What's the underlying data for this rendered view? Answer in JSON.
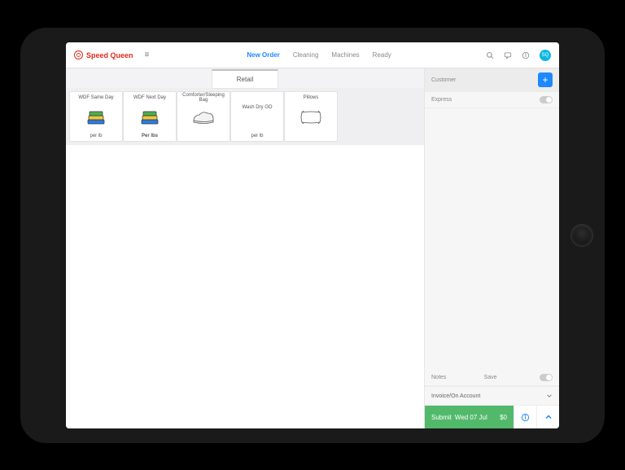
{
  "brand": {
    "name": "Speed Queen"
  },
  "nav": {
    "items": [
      {
        "label": "New Order",
        "active": true
      },
      {
        "label": "Cleaning"
      },
      {
        "label": "Machines"
      },
      {
        "label": "Ready"
      }
    ]
  },
  "avatar": {
    "initials": "SQ"
  },
  "tab": {
    "label": "Retail"
  },
  "tiles": [
    {
      "title": "WDF Same Day",
      "footer": "per lb",
      "icon": "stack"
    },
    {
      "title": "WDF Next Day",
      "footer": "Per lbs",
      "icon": "stack",
      "boldFooter": true
    },
    {
      "title": "Comforter/Sleeping Bag",
      "footer": "",
      "icon": "comforter"
    },
    {
      "title": "Wash Dry GO",
      "footer": "per lb",
      "icon": "none"
    },
    {
      "title": "Pillows",
      "footer": "",
      "icon": "pillow"
    }
  ],
  "side": {
    "customer": "Customer",
    "express": "Express",
    "notes": "Notes",
    "save": "Save",
    "invoice": "Invoice/On Account"
  },
  "submit": {
    "label": "Submit",
    "date": "Wed 07 Jul",
    "amount": "$0"
  }
}
